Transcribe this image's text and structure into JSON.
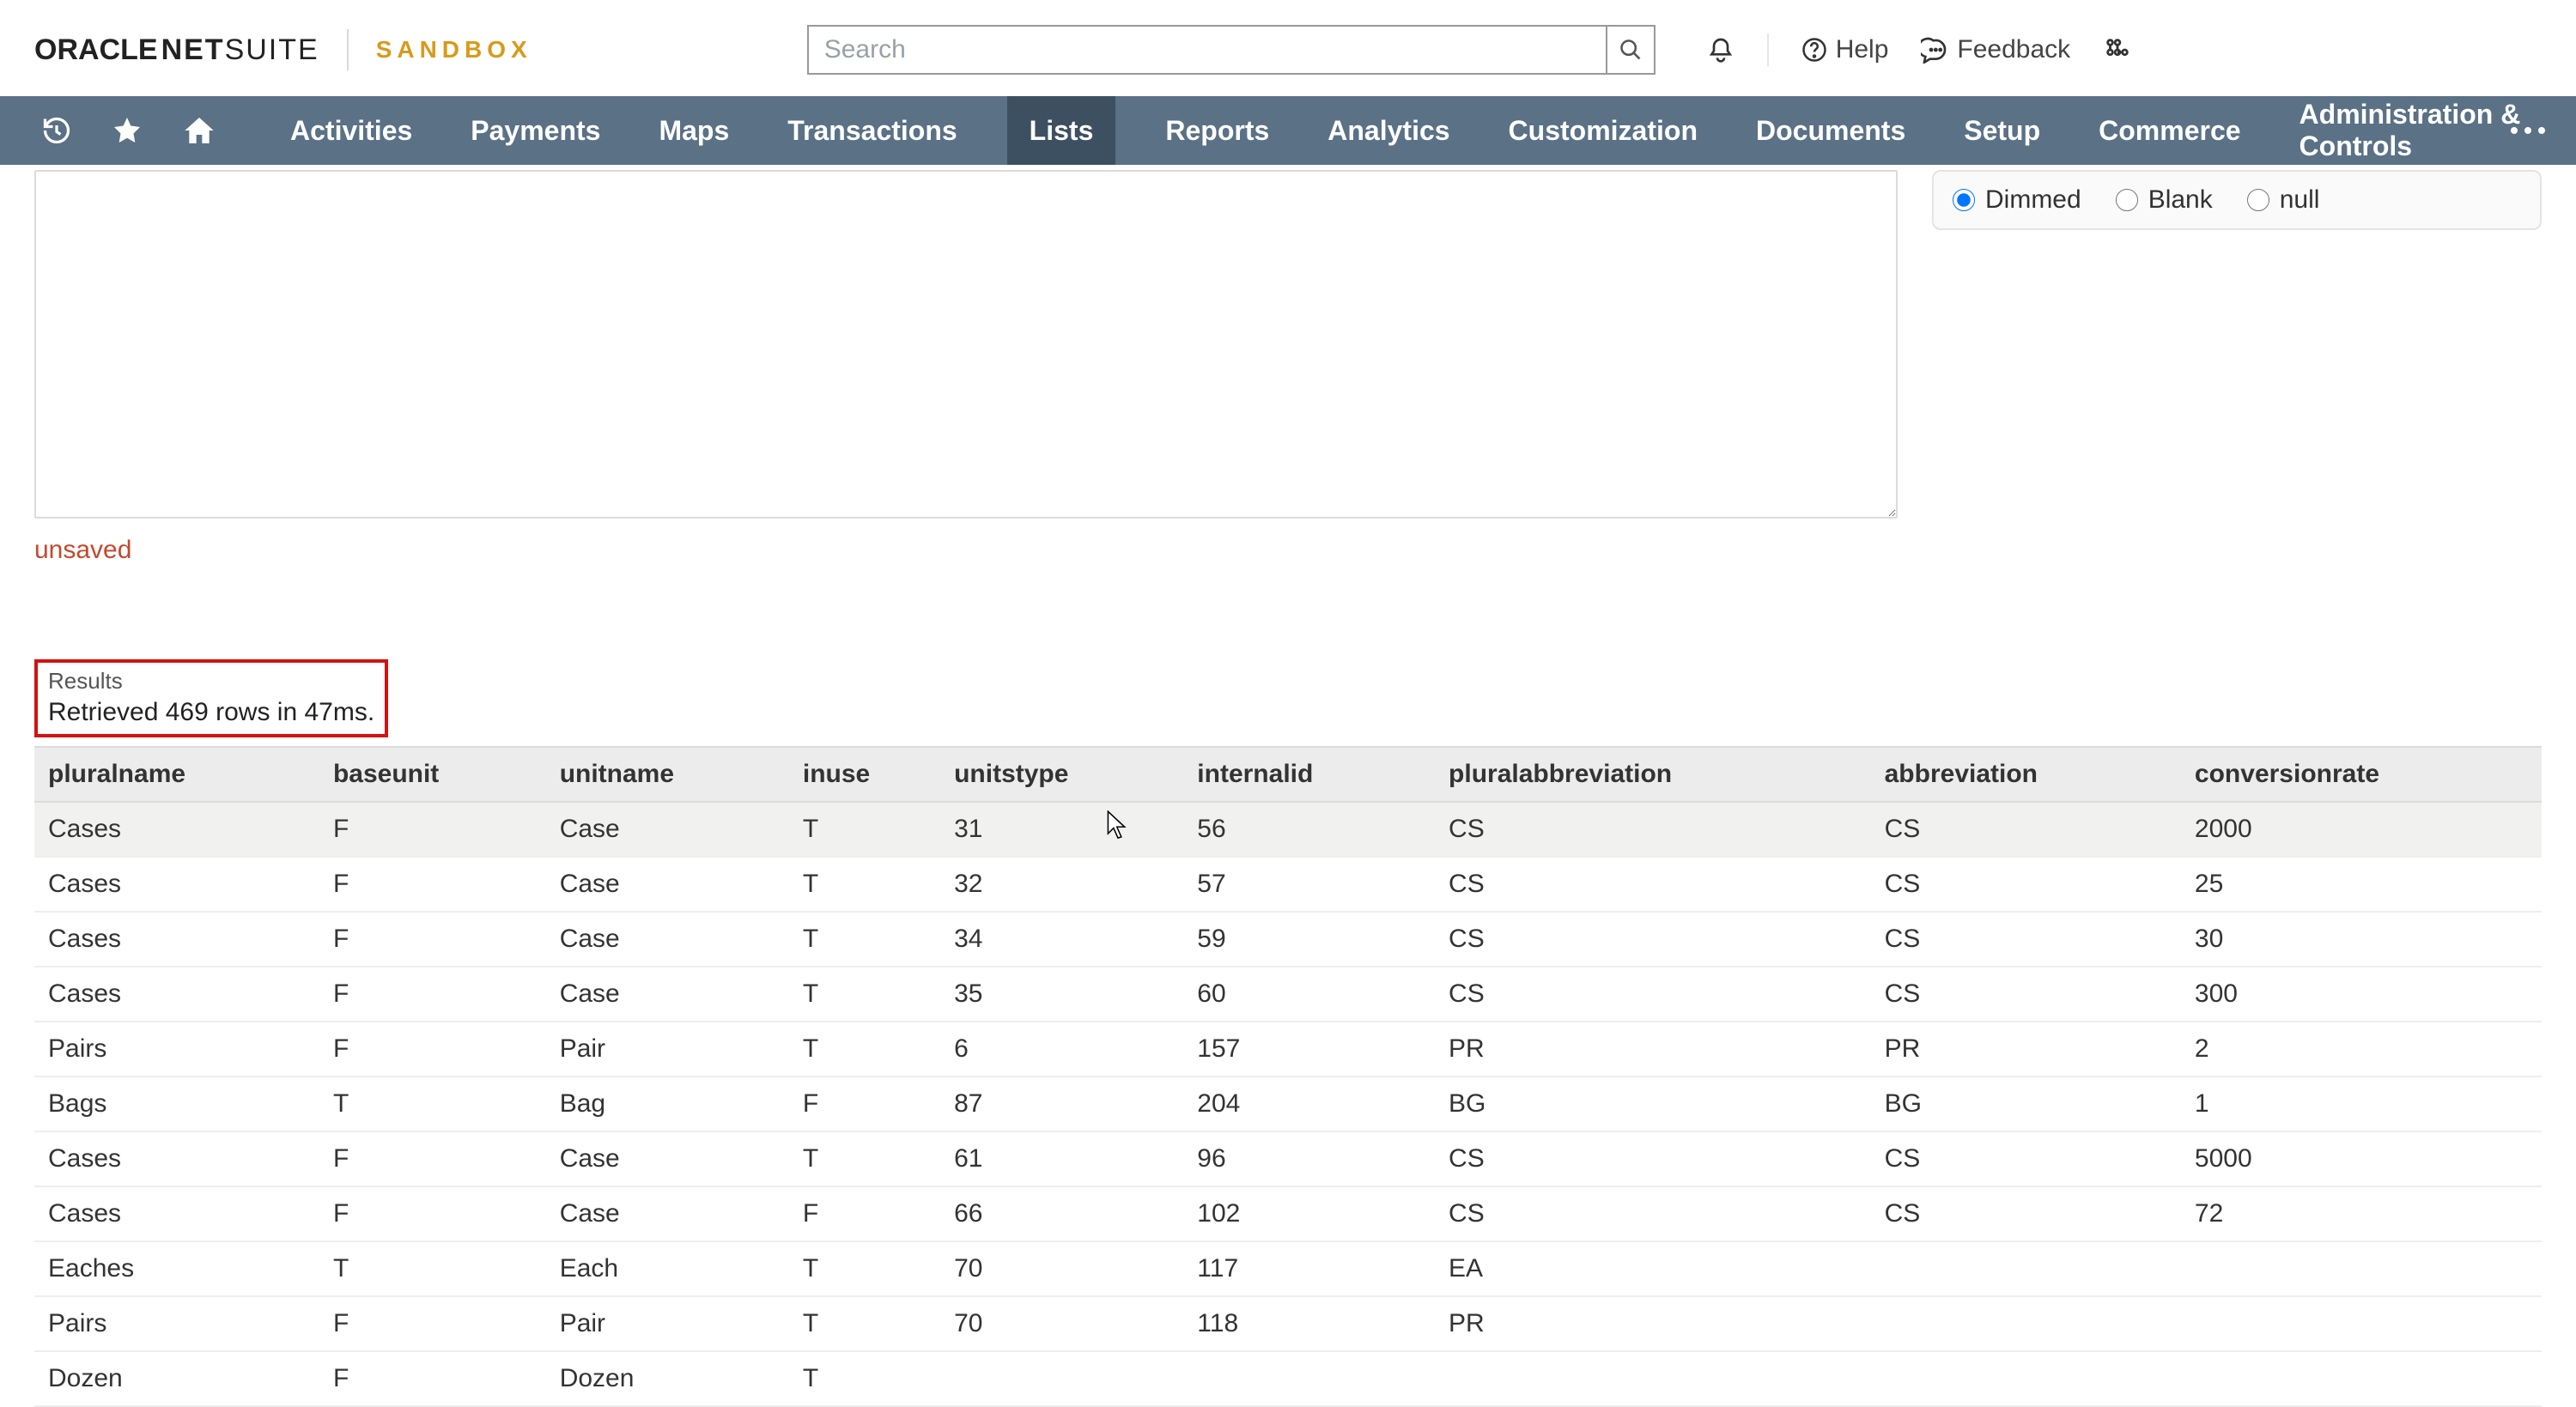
{
  "header": {
    "brand_oracle": "ORACLE",
    "brand_netsuite_bold": "NET",
    "brand_netsuite_thin": "SUITE",
    "sandbox_label": "SANDBOX",
    "search_placeholder": "Search",
    "help_label": "Help",
    "feedback_label": "Feedback"
  },
  "nav": {
    "items": [
      "Activities",
      "Payments",
      "Maps",
      "Transactions",
      "Lists",
      "Reports",
      "Analytics",
      "Customization",
      "Documents",
      "Setup",
      "Commerce",
      "Administration & Controls"
    ],
    "active_index": 4
  },
  "options": {
    "radios": [
      "Dimmed",
      "Blank",
      "null"
    ],
    "selected": "Dimmed"
  },
  "editor": {
    "status_text": "unsaved"
  },
  "results": {
    "label": "Results",
    "summary": "Retrieved 469 rows in 47ms.",
    "columns": [
      "pluralname",
      "baseunit",
      "unitname",
      "inuse",
      "unitstype",
      "internalid",
      "pluralabbreviation",
      "abbreviation",
      "conversionrate"
    ],
    "rows": [
      [
        "Cases",
        "F",
        "Case",
        "T",
        "31",
        "56",
        "CS",
        "CS",
        "2000"
      ],
      [
        "Cases",
        "F",
        "Case",
        "T",
        "32",
        "57",
        "CS",
        "CS",
        "25"
      ],
      [
        "Cases",
        "F",
        "Case",
        "T",
        "34",
        "59",
        "CS",
        "CS",
        "30"
      ],
      [
        "Cases",
        "F",
        "Case",
        "T",
        "35",
        "60",
        "CS",
        "CS",
        "300"
      ],
      [
        "Pairs",
        "F",
        "Pair",
        "T",
        "6",
        "157",
        "PR",
        "PR",
        "2"
      ],
      [
        "Bags",
        "T",
        "Bag",
        "F",
        "87",
        "204",
        "BG",
        "BG",
        "1"
      ],
      [
        "Cases",
        "F",
        "Case",
        "T",
        "61",
        "96",
        "CS",
        "CS",
        "5000"
      ],
      [
        "Cases",
        "F",
        "Case",
        "F",
        "66",
        "102",
        "CS",
        "CS",
        "72"
      ],
      [
        "Eaches",
        "T",
        "Each",
        "T",
        "70",
        "117",
        "EA",
        "",
        ""
      ],
      [
        "Pairs",
        "F",
        "Pair",
        "T",
        "70",
        "118",
        "PR",
        "",
        ""
      ],
      [
        "Dozen",
        "F",
        "Dozen",
        "T",
        "",
        "",
        "",
        "",
        ""
      ]
    ],
    "column_widths": [
      "340",
      "270",
      "290",
      "180",
      "290",
      "300",
      "520",
      "370",
      "430"
    ]
  }
}
